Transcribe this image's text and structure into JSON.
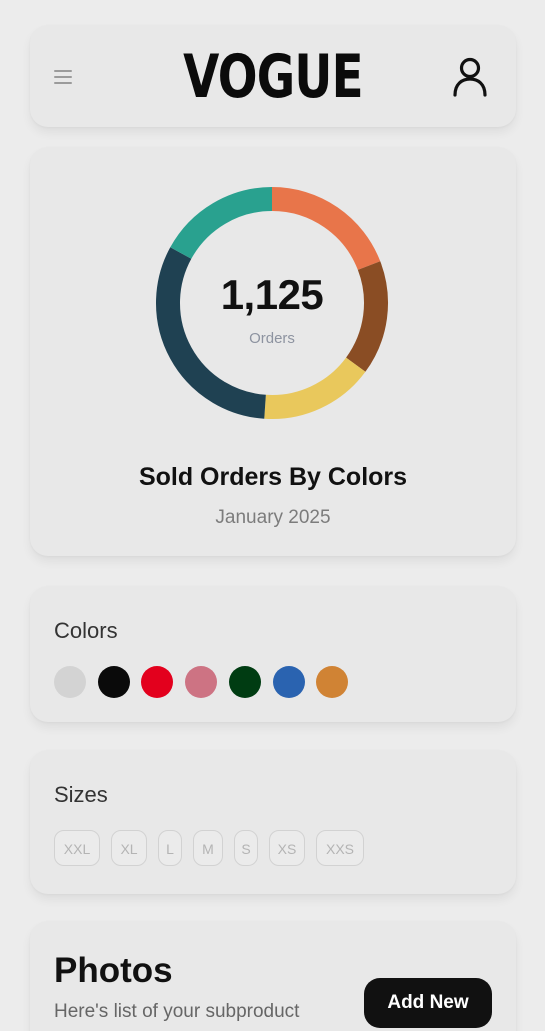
{
  "header": {
    "logo": "VOGUE",
    "menu_icon": "hamburger-menu-icon",
    "profile_icon": "user-icon"
  },
  "chart_card": {
    "total_value": "1,125",
    "total_label": "Orders",
    "title": "Sold Orders By Colors",
    "subtitle": "January 2025"
  },
  "chart_data": {
    "type": "pie",
    "title": "Sold Orders By Colors",
    "subtitle": "January 2025",
    "center_value": "1,125",
    "center_label": "Orders",
    "series": [
      {
        "color": "#e8754a",
        "value": 0.18
      },
      {
        "color": "#8a4d24",
        "value": 0.15
      },
      {
        "color": "#e9c85c",
        "value": 0.15
      },
      {
        "color": "#1f4152",
        "value": 0.3
      },
      {
        "color": "#29a18f",
        "value": 0.16
      }
    ]
  },
  "colors_section": {
    "label": "Colors",
    "swatches": [
      {
        "name": "light-gray",
        "hex": "#d3d3d3"
      },
      {
        "name": "black",
        "hex": "#0a0a0a"
      },
      {
        "name": "red",
        "hex": "#e3001d"
      },
      {
        "name": "pink",
        "hex": "#cd7383"
      },
      {
        "name": "dark-green",
        "hex": "#003c12"
      },
      {
        "name": "blue",
        "hex": "#2a63b0"
      },
      {
        "name": "orange",
        "hex": "#d08334"
      }
    ]
  },
  "sizes_section": {
    "label": "Sizes",
    "sizes": [
      "XXL",
      "XL",
      "L",
      "M",
      "S",
      "XS",
      "XXS"
    ]
  },
  "photos_section": {
    "title": "Photos",
    "subtitle": "Here's list of your subproduct",
    "add_button_label": "Add New"
  },
  "colors": {
    "background": "#ececec",
    "card": "#e8e8e8",
    "text": "#111111",
    "button_bg": "#111111"
  }
}
